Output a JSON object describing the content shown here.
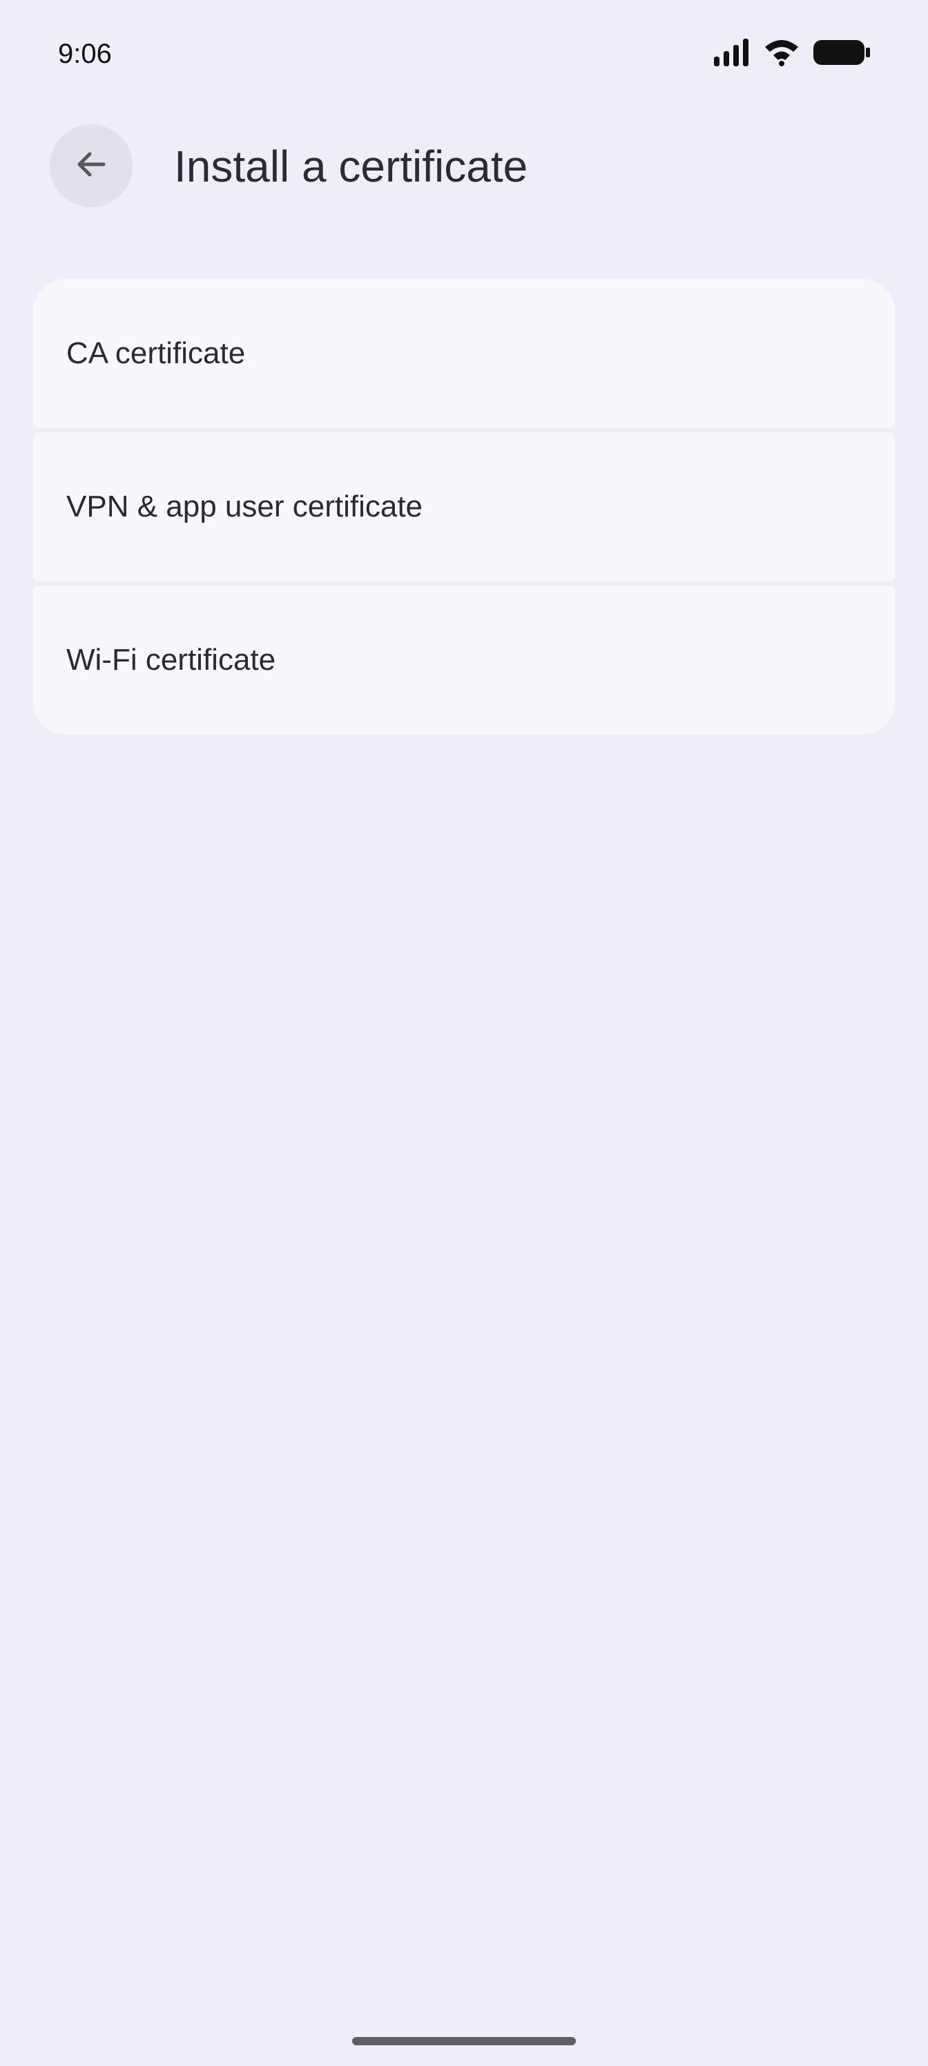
{
  "status_bar": {
    "time": "9:06",
    "icons": [
      "signal-icon",
      "wifi-icon",
      "battery-icon"
    ]
  },
  "header": {
    "back_icon": "arrow-back-icon",
    "title": "Install a certificate"
  },
  "certificate_options": [
    {
      "label": "CA certificate"
    },
    {
      "label": "VPN & app user certificate"
    },
    {
      "label": "Wi-Fi certificate"
    }
  ],
  "colors": {
    "background": "#eeeef7",
    "card": "#f8f8fc",
    "back_button_bg": "#e1e1ea",
    "text": "#2a2a30"
  }
}
